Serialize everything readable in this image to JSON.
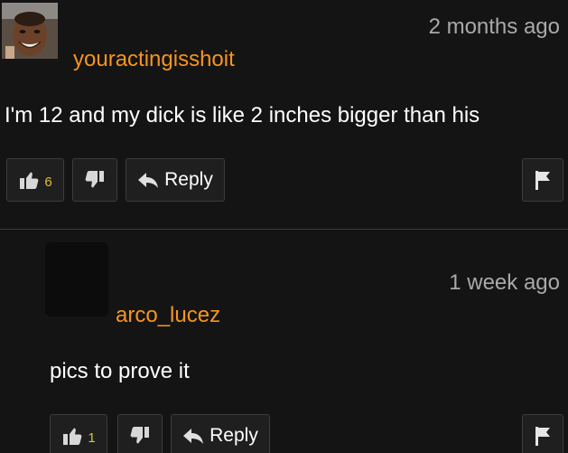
{
  "comments": [
    {
      "username": "youractingisshoit",
      "timestamp": "2 months ago",
      "text": "I'm 12 and my dick is like 2 inches bigger than his",
      "likes": "6",
      "reply_label": "Reply"
    },
    {
      "username": "arco_lucez",
      "timestamp": "1 week ago",
      "text": "pics to prove it",
      "likes": "1",
      "reply_label": "Reply"
    }
  ],
  "colors": {
    "background": "#141414",
    "username": "#f7951d",
    "timestamp": "#a9a9a9",
    "text": "#ffffff",
    "like_count": "#ddc234",
    "button_bg": "#1f1f1f"
  }
}
